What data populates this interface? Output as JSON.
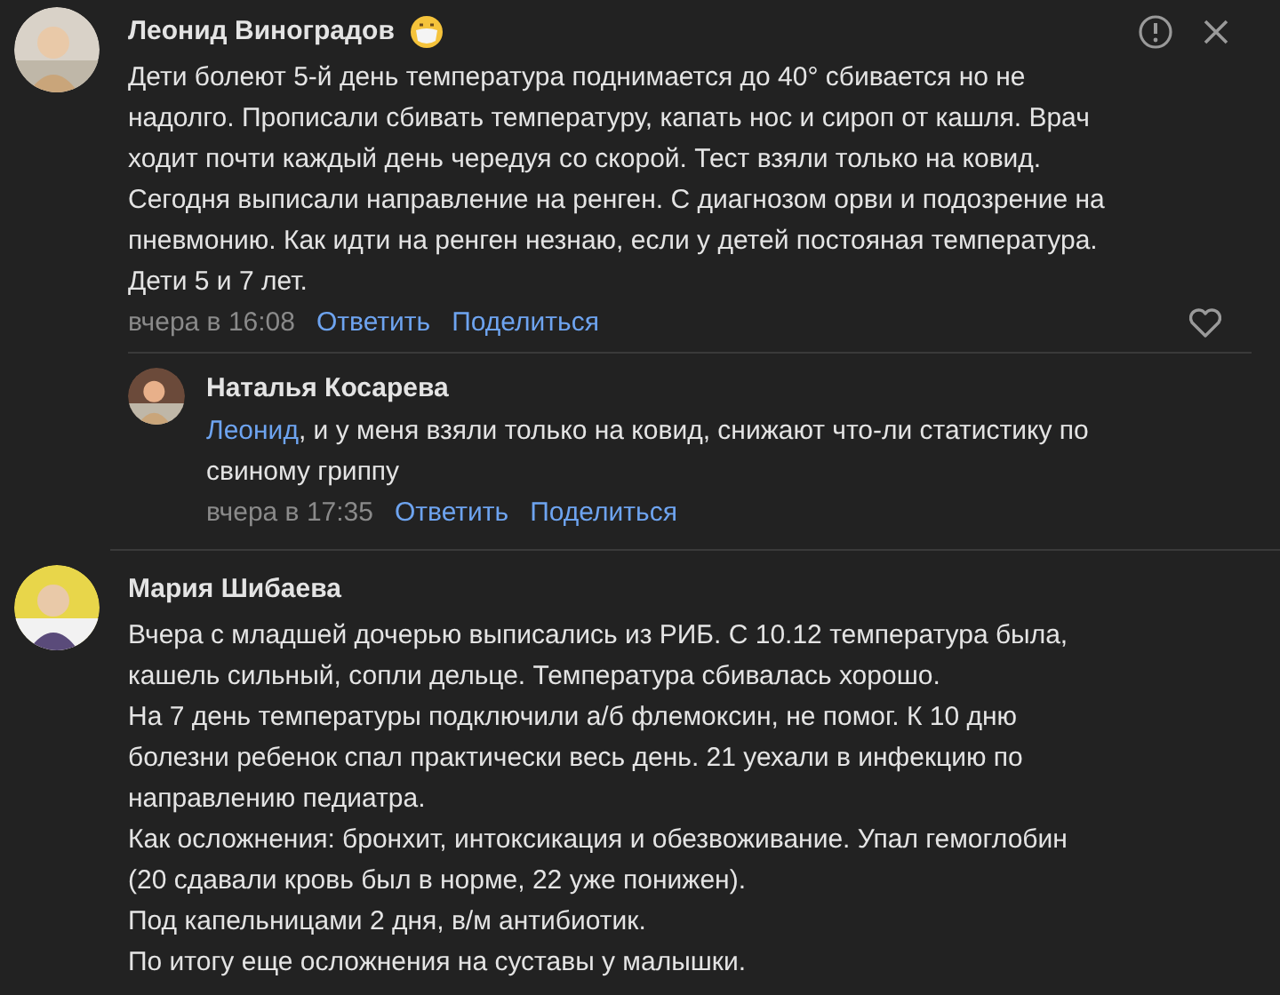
{
  "comments": [
    {
      "author": "Леонид Виноградов",
      "emoji": true,
      "report_icon": true,
      "close_icon": true,
      "paragraphs": [
        "Дети болеют 5-й день температура поднимается до 40° сбивается но не надолго. Прописали сбивать температуру, капать нос и сироп от кашля. Врач ходит почти каждый день чередуя со скорой. Тест взяли только на ковид. Сегодня выписали направление на ренген. С диагнозом орви и подозрение на пневмонию. Как идти на ренген незнаю, если у детей постояная температура. Дети 5 и 7 лет."
      ],
      "time": "вчера в 16:08",
      "actions": [
        "Ответить",
        "Поделиться"
      ],
      "like": true,
      "replies": [
        {
          "author": "Наталья Косарева",
          "mention": "Леонид",
          "text": ", и у меня взяли только на ковид, снижают что-ли статистику по свиному гриппу",
          "time": "вчера в 17:35",
          "actions": [
            "Ответить",
            "Поделиться"
          ]
        }
      ]
    },
    {
      "author": "Мария Шибаева",
      "emoji": false,
      "report_icon": false,
      "close_icon": false,
      "paragraphs": [
        "Вчера с младшей дочерью выписались из РИБ. С 10.12 температура была, кашель сильный, сопли дельце. Температура сбивалась хорошо.",
        "На 7 день температуры подключили а/б флемоксин, не помог. К 10 дню болезни ребенок спал практически весь день. 21 уехали в инфекцию по направлению педиатра.",
        "Как осложнения: бронхит, интоксикация и обезвоживание. Упал гемоглобин (20 сдавали кровь был в норме, 22 уже понижен).",
        "Под капельницами 2 дня, в/м антибиотик.",
        "По итогу еще осложнения на суставы у малышки."
      ],
      "like": false
    }
  ]
}
